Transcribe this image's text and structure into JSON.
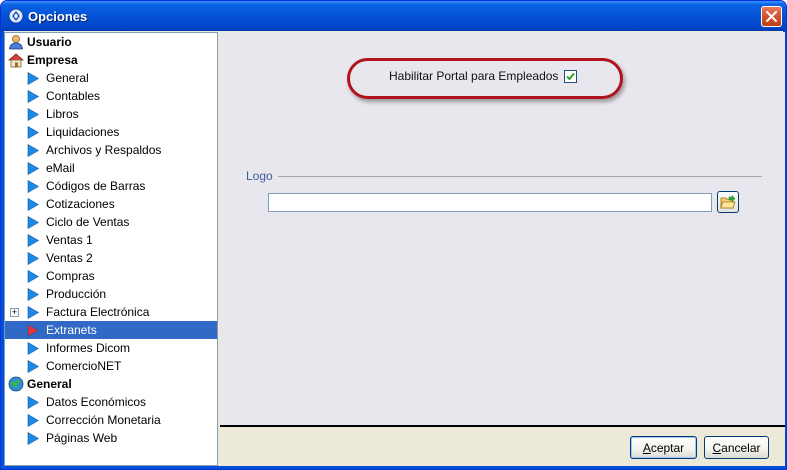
{
  "window": {
    "title": "Opciones"
  },
  "tree": {
    "groups": [
      {
        "label": "Usuario",
        "icon": "user-icon",
        "items": []
      },
      {
        "label": "Empresa",
        "icon": "house-icon",
        "items": [
          "General",
          "Contables",
          "Libros",
          "Liquidaciones",
          "Archivos y Respaldos",
          "eMail",
          "Códigos de Barras",
          "Cotizaciones",
          "Ciclo de Ventas",
          "Ventas 1",
          "Ventas 2",
          "Compras",
          "Producción",
          "Factura Electrónica",
          "Extranets",
          "Informes Dicom",
          "ComercioNET"
        ]
      },
      {
        "label": "General",
        "icon": "globe-icon",
        "items": [
          "Datos Económicos",
          "Corrección Monetaria",
          "Páginas Web"
        ]
      }
    ],
    "selected": "Extranets",
    "expandable": "Factura Electrónica"
  },
  "content": {
    "portal_label": "Habilitar Portal para Empleados",
    "portal_checked": true,
    "logo_legend": "Logo",
    "logo_value": ""
  },
  "buttons": {
    "accept_label": "Aceptar",
    "cancel_label": "Cancelar"
  },
  "colors": {
    "titlebar": "#0452d6",
    "selection": "#3169c6",
    "highlight_oval": "#b0131c",
    "arrow": "#1e88e5",
    "selected_arrow": "#e8323c"
  }
}
